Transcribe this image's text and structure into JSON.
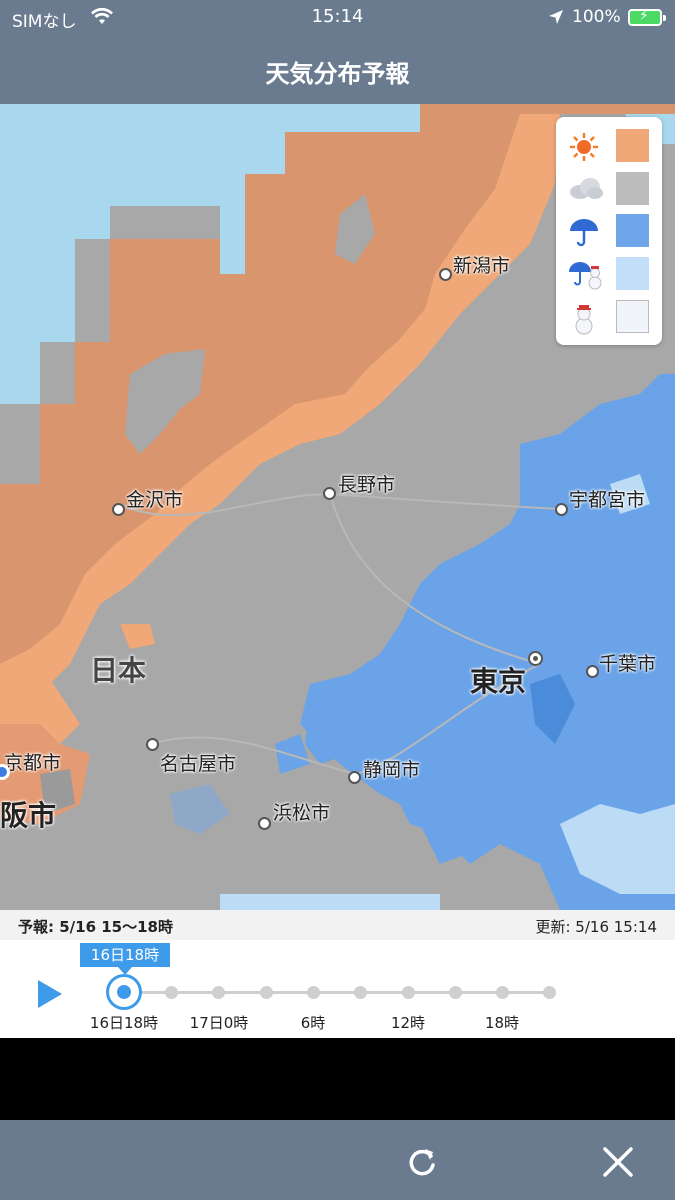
{
  "status_bar": {
    "carrier": "SIMなし",
    "time": "15:14",
    "battery": "100%"
  },
  "header": {
    "title": "天気分布予報"
  },
  "map": {
    "cities": [
      {
        "name": "新潟市"
      },
      {
        "name": "長野市"
      },
      {
        "name": "金沢市"
      },
      {
        "name": "宇都宮市"
      },
      {
        "name": "千葉市"
      },
      {
        "name": "東京"
      },
      {
        "name": "京都市"
      },
      {
        "name": "名古屋市"
      },
      {
        "name": "静岡市"
      },
      {
        "name": "浜松市"
      },
      {
        "name": "阪市"
      },
      {
        "name": "日本"
      }
    ],
    "colors": {
      "sunny": "#f0a878",
      "cloudy": "#a8a8a8",
      "rain": "#6aa3e8",
      "rain_snow": "#bcdcf6",
      "snow": "#eef2fb",
      "sea": "#a9d8ee"
    }
  },
  "legend": {
    "items": [
      {
        "icon": "sun-icon",
        "color": "#f0a878"
      },
      {
        "icon": "cloud-icon",
        "color": "#bcbcbc"
      },
      {
        "icon": "umbrella-icon",
        "color": "#6fa6ea"
      },
      {
        "icon": "umbrella-snowman-icon",
        "color": "#c2def8"
      },
      {
        "icon": "snowman-icon",
        "color": "#f2f4fb"
      }
    ]
  },
  "info_bar": {
    "forecast": "予報: 5/16 15〜18時",
    "updated": "更新: 5/16 15:14"
  },
  "timeline": {
    "selected_badge": "16日18時",
    "labels": [
      "16日18時",
      "17日0時",
      "6時",
      "12時",
      "18時"
    ]
  }
}
